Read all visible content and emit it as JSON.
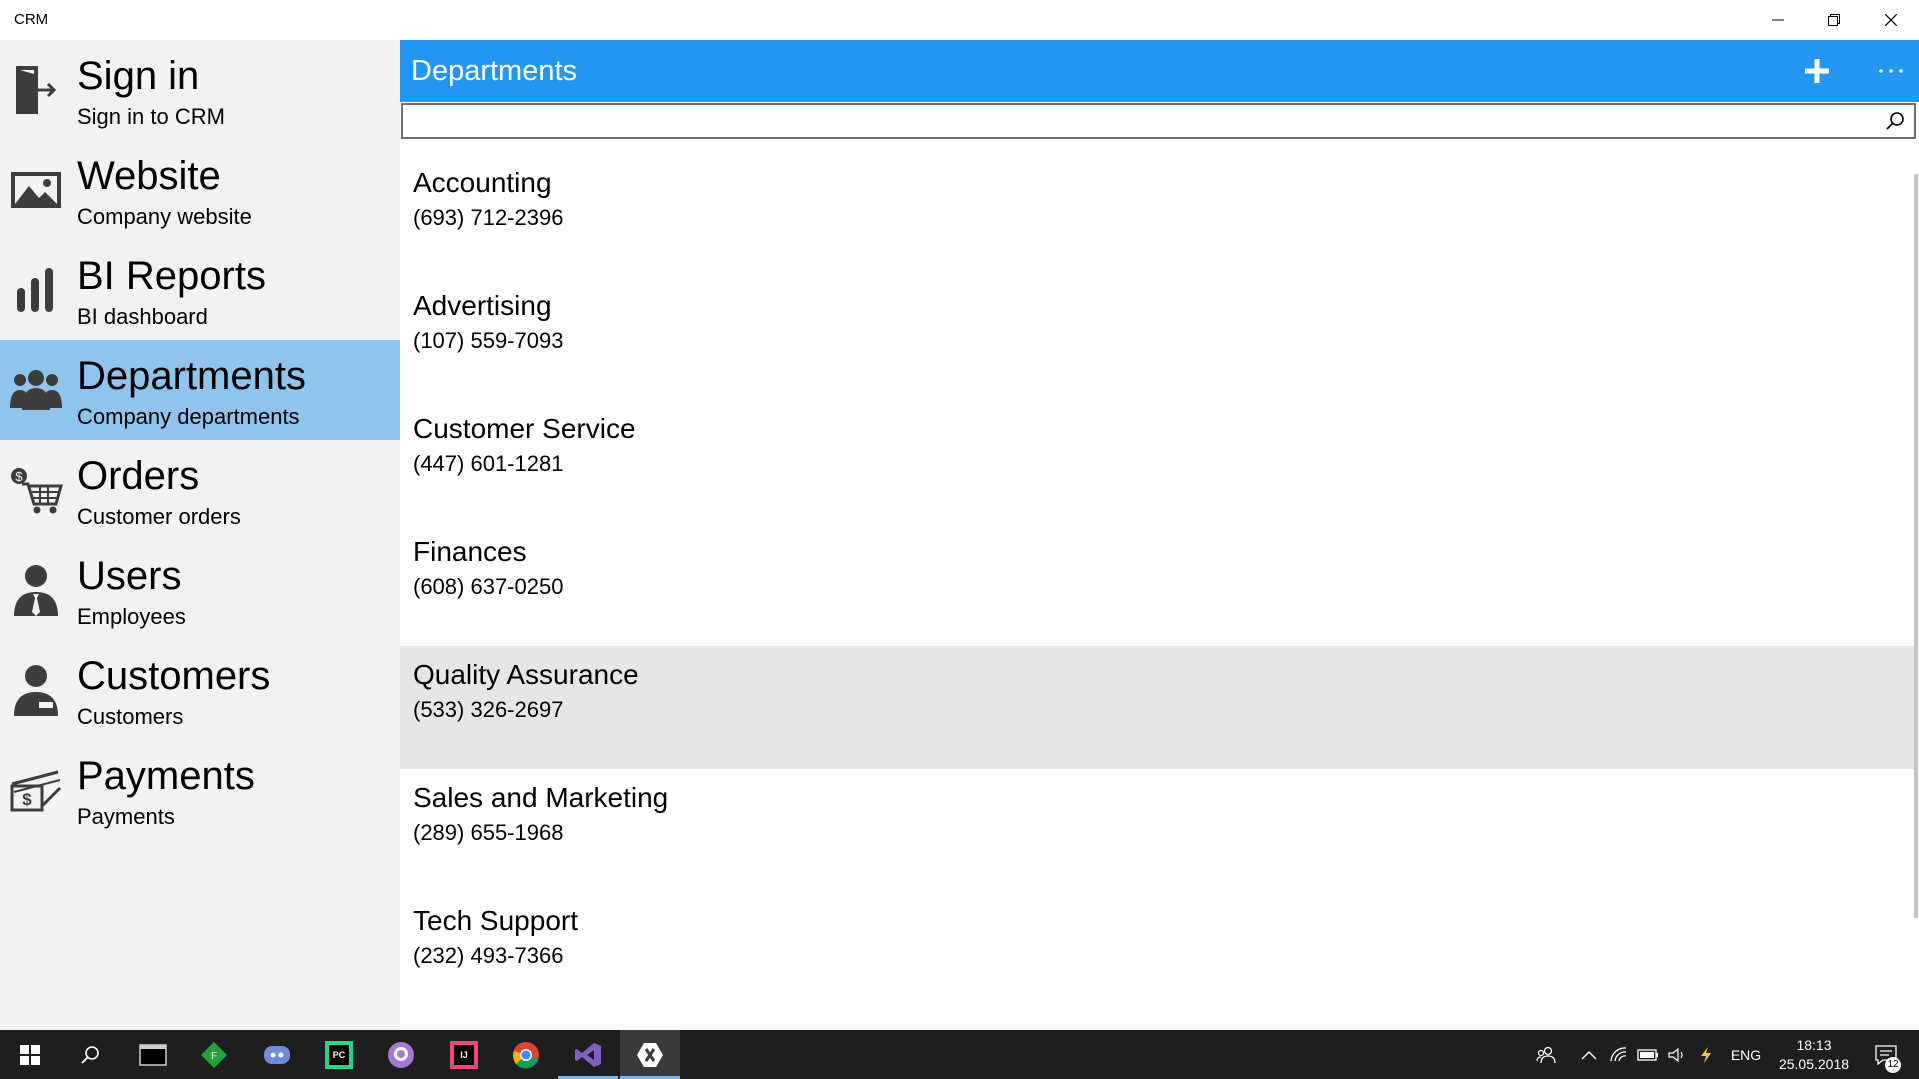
{
  "window": {
    "title": "CRM",
    "controls": [
      "minimize-icon",
      "restore-icon",
      "close-icon"
    ]
  },
  "sidebar": {
    "selected_index": 3,
    "items": [
      {
        "title": "Sign in",
        "subtitle": "Sign in to CRM",
        "icon": "sign-in-icon"
      },
      {
        "title": "Website",
        "subtitle": "Company website",
        "icon": "website-icon"
      },
      {
        "title": "BI Reports",
        "subtitle": "BI dashboard",
        "icon": "bar-chart-icon"
      },
      {
        "title": "Departments",
        "subtitle": "Company departments",
        "icon": "people-group-icon"
      },
      {
        "title": "Orders",
        "subtitle": "Customer orders",
        "icon": "shopping-cart-icon"
      },
      {
        "title": "Users",
        "subtitle": "Employees",
        "icon": "employee-icon"
      },
      {
        "title": "Customers",
        "subtitle": "Customers",
        "icon": "customer-icon"
      },
      {
        "title": "Payments",
        "subtitle": "Payments",
        "icon": "payment-icon"
      }
    ]
  },
  "header": {
    "title": "Departments",
    "add_icon": "plus-icon",
    "more_icon": "more-icon"
  },
  "search": {
    "value": "",
    "placeholder": "",
    "icon": "search-icon"
  },
  "departments": [
    {
      "name": "Accounting",
      "phone": "(693) 712-2396"
    },
    {
      "name": "Advertising",
      "phone": "(107) 559-7093"
    },
    {
      "name": "Customer Service",
      "phone": "(447) 601-1281"
    },
    {
      "name": "Finances",
      "phone": "(608) 637-0250"
    },
    {
      "name": "Quality Assurance",
      "phone": "(533) 326-2697"
    },
    {
      "name": "Sales and Marketing",
      "phone": "(289) 655-1968"
    },
    {
      "name": "Tech Support",
      "phone": "(232) 493-7366"
    }
  ],
  "taskbar": {
    "apps": [
      "start-icon",
      "search-icon",
      "terminal-icon",
      "freeplane-icon",
      "discord-icon",
      "pycharm-icon",
      "github-icon",
      "intellij-icon",
      "chrome-icon",
      "visual-studio-icon",
      "xamarin-icon"
    ],
    "active_app": "xamarin-icon",
    "language": "ENG",
    "time": "18:13",
    "date": "25.05.2018",
    "notification_count": "12"
  },
  "colors": {
    "accent": "#2196f3",
    "selected": "#8fc4ec",
    "sidebar_bg": "#f2f2f2",
    "highlight_row": "#e6e6e6",
    "taskbar": "#1e1e1e"
  }
}
